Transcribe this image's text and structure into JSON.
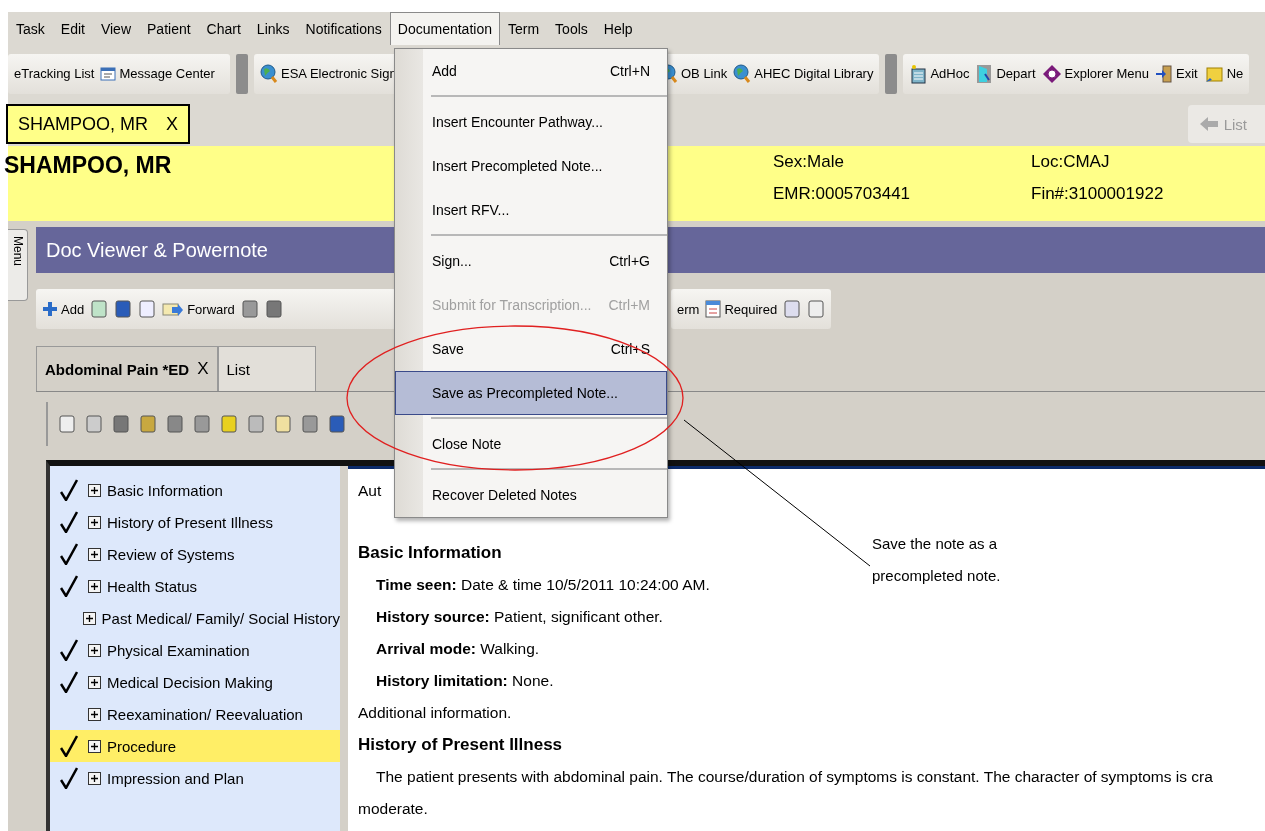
{
  "menubar": [
    {
      "label": "Task",
      "selected": false
    },
    {
      "label": "Edit",
      "selected": false
    },
    {
      "label": "View",
      "selected": false
    },
    {
      "label": "Patient",
      "selected": false
    },
    {
      "label": "Chart",
      "selected": false
    },
    {
      "label": "Links",
      "selected": false
    },
    {
      "label": "Notifications",
      "selected": false
    },
    {
      "label": "Documentation",
      "selected": true
    },
    {
      "label": "Term",
      "selected": false
    },
    {
      "label": "Tools",
      "selected": false
    },
    {
      "label": "Help",
      "selected": false
    }
  ],
  "toolbar_left": [
    {
      "label": "eTracking List",
      "kind": "plain"
    },
    {
      "label": "Message Center",
      "kind": "message"
    },
    {
      "label": "ESA Electronic Sign",
      "kind": "globe"
    }
  ],
  "toolbar_right": [
    {
      "label": "OB Link",
      "kind": "globe"
    },
    {
      "label": "AHEC Digital Library",
      "kind": "globe"
    },
    {
      "label": "AdHoc",
      "kind": "adhoc"
    },
    {
      "label": "Depart",
      "kind": "depart"
    },
    {
      "label": "Explorer Menu",
      "kind": "explorer"
    },
    {
      "label": "Exit",
      "kind": "exit"
    },
    {
      "label": "Ne",
      "kind": "new"
    }
  ],
  "patient_tab": {
    "name": "SHAMPOO, MR",
    "close": "X"
  },
  "back_button": {
    "label": "List",
    "disabled": true
  },
  "banner": {
    "name": "SHAMPOO, MR",
    "sex": "Sex:Male",
    "emr": "EMR:0005703441",
    "loc": "Loc:CMAJ",
    "fin": "Fin#:3100001922"
  },
  "side_tab": {
    "label": "Menu"
  },
  "panel": {
    "title": "Doc Viewer & Powernote"
  },
  "doc_toolbar_left": [
    {
      "label": "Add",
      "kind": "add"
    },
    {
      "label": "Forward",
      "kind": "forward"
    }
  ],
  "doc_toolbar_right": [
    {
      "label": "erm",
      "kind": "plain"
    },
    {
      "label": "Required",
      "kind": "required"
    }
  ],
  "note_tabs": [
    {
      "label": "Abdominal Pain *ED",
      "close": "X",
      "selected": true
    },
    {
      "label": "List",
      "selected": false
    }
  ],
  "outline": [
    {
      "label": "Basic Information",
      "checked": true,
      "selected": false
    },
    {
      "label": "History of Present Illness",
      "checked": true,
      "selected": false
    },
    {
      "label": "Review of Systems",
      "checked": true,
      "selected": false
    },
    {
      "label": "Health Status",
      "checked": true,
      "selected": false
    },
    {
      "label": "Past Medical/ Family/ Social History",
      "checked": false,
      "selected": false
    },
    {
      "label": "Physical Examination",
      "checked": true,
      "selected": false
    },
    {
      "label": "Medical Decision Making",
      "checked": true,
      "selected": false
    },
    {
      "label": "Reexamination/ Reevaluation",
      "checked": false,
      "selected": false
    },
    {
      "label": "Procedure",
      "checked": true,
      "selected": true
    },
    {
      "label": "Impression and Plan",
      "checked": true,
      "selected": false
    }
  ],
  "document": [
    {
      "kind": "text",
      "text": "Aut"
    },
    {
      "kind": "gap"
    },
    {
      "kind": "heading",
      "text": "Basic Information"
    },
    {
      "kind": "field",
      "label": "Time seen:",
      "text": "Date & time 10/5/2011 10:24:00 AM."
    },
    {
      "kind": "field",
      "label": "History source:",
      "text": "Patient, significant other."
    },
    {
      "kind": "field",
      "label": "Arrival mode:",
      "text": "Walking."
    },
    {
      "kind": "field",
      "label": "History limitation:",
      "text": "None."
    },
    {
      "kind": "text",
      "text": "Additional information."
    },
    {
      "kind": "heading",
      "text": "History of Present Illness"
    },
    {
      "kind": "paragraph",
      "text": "The patient presents with abdominal pain.  The course/duration of symptoms is constant.  The character of symptoms is cra"
    },
    {
      "kind": "text",
      "text": "moderate."
    }
  ],
  "menu": [
    {
      "kind": "item",
      "label": "Add",
      "shortcut": "Ctrl+N",
      "disabled": false,
      "selected": false
    },
    {
      "kind": "separator"
    },
    {
      "kind": "item",
      "label": "Insert Encounter Pathway...",
      "disabled": false,
      "selected": false
    },
    {
      "kind": "item",
      "label": "Insert Precompleted Note...",
      "disabled": false,
      "selected": false
    },
    {
      "kind": "item",
      "label": "Insert RFV...",
      "disabled": false,
      "selected": false
    },
    {
      "kind": "separator"
    },
    {
      "kind": "item",
      "label": "Sign...",
      "shortcut": "Ctrl+G",
      "disabled": false,
      "selected": false
    },
    {
      "kind": "item",
      "label": "Submit for Transcription...",
      "shortcut": "Ctrl+M",
      "disabled": true,
      "selected": false
    },
    {
      "kind": "item",
      "label": "Save",
      "shortcut": "Ctrl+S",
      "disabled": false,
      "selected": false
    },
    {
      "kind": "item",
      "label": "Save as Precompleted Note...",
      "disabled": false,
      "selected": true
    },
    {
      "kind": "separator"
    },
    {
      "kind": "item",
      "label": "Close Note",
      "disabled": false,
      "selected": false
    },
    {
      "kind": "separator"
    },
    {
      "kind": "item",
      "label": "Recover Deleted Notes",
      "disabled": false,
      "selected": false
    }
  ],
  "callout": {
    "text": "Save the note as a precompleted note."
  }
}
